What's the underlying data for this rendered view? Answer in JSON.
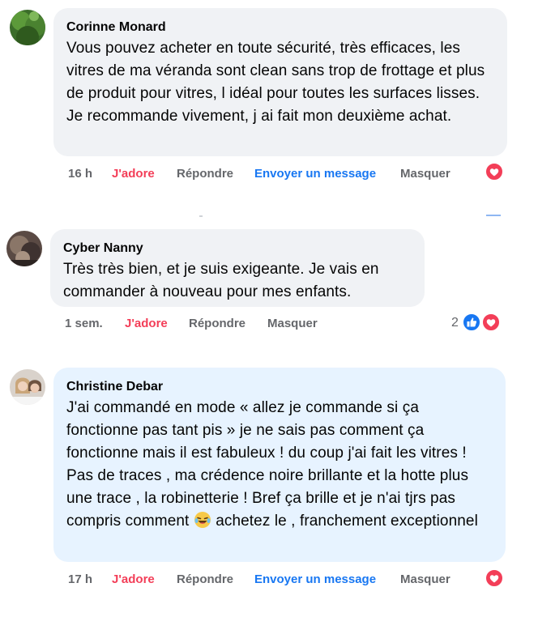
{
  "comments": [
    {
      "author": "Corinne Monard",
      "text": "Vous pouvez acheter en toute sécurité, très efficaces, les vitres de ma véranda sont clean sans trop de frottage et plus de produit pour vitres, l idéal pour toutes les surfaces lisses. Je recommande vivement, j ai fait mon deuxième achat.",
      "time": "16 h",
      "reaction_label": "J'adore",
      "reply_label": "Répondre",
      "message_label": "Envoyer un message",
      "hide_label": "Masquer",
      "reaction_icon": "love-icon"
    },
    {
      "author": "Cyber Nanny",
      "text": "Très très bien, et je suis exigeante. Je vais en commander à nouveau pour mes enfants.",
      "time": "1 sem.",
      "reaction_label": "J'adore",
      "reply_label": "Répondre",
      "hide_label": "Masquer",
      "reaction_count": "2",
      "reaction_icons": [
        "like-icon",
        "love-icon"
      ]
    },
    {
      "author": "Christine Debar",
      "text_part1": "J'ai commandé en mode « allez je commande si ça fonctionne pas tant pis » je ne sais pas comment ça fonctionne mais il est fabuleux ! du coup j'ai fait les vitres ! Pas de traces , ma crédence noire brillante et la hotte plus une trace , la robinetterie ! Bref ça brille et je n'ai tjrs pas compris comment",
      "text_part2": " achetez le , franchement exceptionnel",
      "emoji": "laughing-emoji",
      "time": "17 h",
      "reaction_label": "J'adore",
      "reply_label": "Répondre",
      "message_label": "Envoyer un message",
      "hide_label": "Masquer",
      "reaction_icon": "love-icon"
    }
  ],
  "colors": {
    "bubble_gray": "#f0f2f5",
    "bubble_blue": "#e7f3ff",
    "love": "#f33e58",
    "link": "#1877f2",
    "meta": "#65676b"
  }
}
